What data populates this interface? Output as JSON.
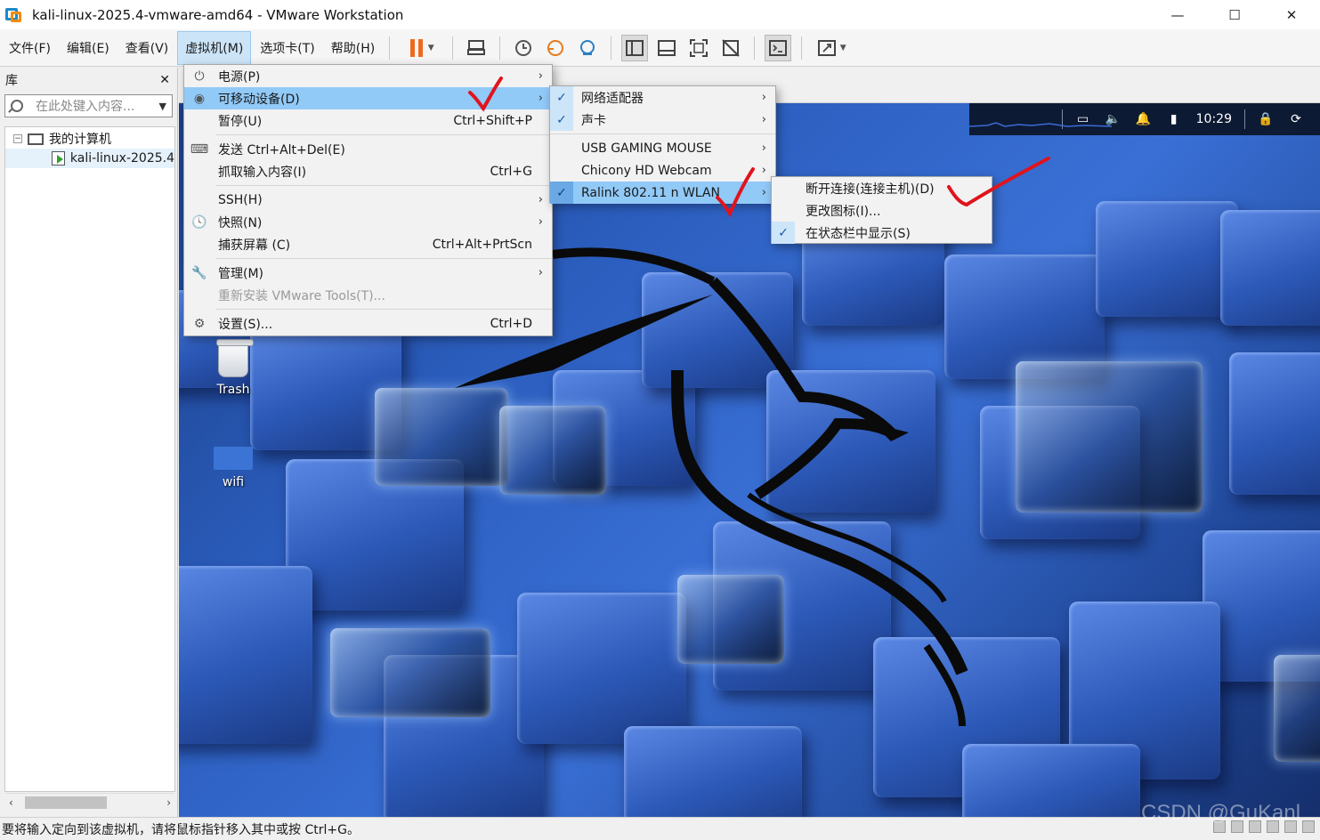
{
  "window": {
    "title": "kali-linux-2025.4-vmware-amd64 - VMware Workstation",
    "minimize": "—",
    "maximize": "☐",
    "close": "✕"
  },
  "menubar": {
    "items": [
      "文件(F)",
      "编辑(E)",
      "查看(V)",
      "虚拟机(M)",
      "选项卡(T)",
      "帮助(H)"
    ],
    "active_index": 3
  },
  "library": {
    "title": "库",
    "close": "✕",
    "search_placeholder": "在此处键入内容...",
    "tree": {
      "root": "我的计算机",
      "vm": "kali-linux-2025.4"
    }
  },
  "guest": {
    "time": "10:29",
    "desktop_icons": [
      "Trash",
      "wifi"
    ]
  },
  "vm_menu": {
    "items": [
      {
        "label": "电源(P)",
        "shortcut": "",
        "submenu": true,
        "icon": "power-icon"
      },
      {
        "label": "可移动设备(D)",
        "shortcut": "",
        "submenu": true,
        "icon": "devices-icon",
        "highlighted": true
      },
      {
        "label": "暂停(U)",
        "shortcut": "Ctrl+Shift+P",
        "submenu": false
      },
      {
        "label": "发送 Ctrl+Alt+Del(E)",
        "shortcut": "",
        "submenu": false,
        "icon": "send-keys-icon"
      },
      {
        "label": "抓取输入内容(I)",
        "shortcut": "Ctrl+G",
        "submenu": false
      },
      {
        "label": "SSH(H)",
        "shortcut": "",
        "submenu": true
      },
      {
        "label": "快照(N)",
        "shortcut": "",
        "submenu": true,
        "icon": "snapshot-icon"
      },
      {
        "label": "捕获屏幕 (C)",
        "shortcut": "Ctrl+Alt+PrtScn",
        "submenu": false
      },
      {
        "label": "管理(M)",
        "shortcut": "",
        "submenu": true,
        "icon": "wrench-icon"
      },
      {
        "label": "重新安装 VMware Tools(T)...",
        "shortcut": "",
        "submenu": false,
        "disabled": true
      },
      {
        "label": "设置(S)...",
        "shortcut": "Ctrl+D",
        "submenu": false,
        "icon": "settings-icon"
      }
    ]
  },
  "devices_menu": {
    "items": [
      {
        "label": "网络适配器",
        "checked": true,
        "submenu": true
      },
      {
        "label": "声卡",
        "checked": true,
        "submenu": true
      },
      {
        "label": "USB GAMING MOUSE",
        "checked": false,
        "submenu": true
      },
      {
        "label": "Chicony HD Webcam",
        "checked": false,
        "submenu": true
      },
      {
        "label": "Ralink 802.11 n WLAN",
        "checked": true,
        "submenu": true,
        "highlighted": true
      }
    ]
  },
  "wlan_menu": {
    "items": [
      {
        "label": "断开连接(连接主机)(D)",
        "checked": false
      },
      {
        "label": "更改图标(I)...",
        "checked": false
      },
      {
        "label": "在状态栏中显示(S)",
        "checked": true
      }
    ]
  },
  "statusbar": {
    "text": "要将输入定向到该虚拟机，请将鼠标指针移入其中或按 Ctrl+G。"
  },
  "watermark": "CSDN @GuKanl",
  "annotation_color": "#e0141c"
}
